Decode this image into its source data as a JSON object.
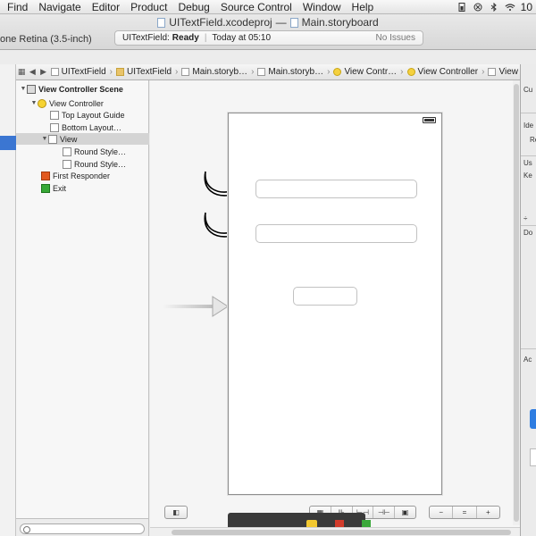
{
  "menu": [
    "Find",
    "Navigate",
    "Editor",
    "Product",
    "Debug",
    "Source Control",
    "Window",
    "Help"
  ],
  "status_bar": {
    "clock_fragment": "10",
    "icons": [
      "battery-status-icon",
      "sync-icon",
      "bluetooth-icon",
      "wifi-icon"
    ]
  },
  "window": {
    "project_file": "UITextField.xcodeproj",
    "separator": "—",
    "storyboard_file": "Main.storyboard"
  },
  "scheme": "one Retina (3.5-inch)",
  "activity": {
    "project": "UITextField:",
    "state": "Ready",
    "separator": "|",
    "time": "Today at 05:10",
    "issues": "No Issues"
  },
  "jumpbar": {
    "crumbs": [
      "UITextField",
      "UITextField",
      "Main.storyb…",
      "Main.storyb…",
      "View Contr…",
      "View Controller",
      "View"
    ],
    "back": "◀",
    "forward": "▶"
  },
  "outline": {
    "items": [
      {
        "label": "View Controller Scene",
        "icon": "scene-icon"
      },
      {
        "label": "View Controller",
        "icon": "view-controller-icon"
      },
      {
        "label": "Top Layout Guide",
        "icon": "layout-guide-icon"
      },
      {
        "label": "Bottom Layout…",
        "icon": "layout-guide-icon"
      },
      {
        "label": "View",
        "icon": "view-icon"
      },
      {
        "label": "Round Style…",
        "icon": "text-field-icon"
      },
      {
        "label": "Round Style…",
        "icon": "text-field-icon"
      },
      {
        "label": "First Responder",
        "icon": "first-responder-icon"
      },
      {
        "label": "Exit",
        "icon": "exit-icon"
      }
    ]
  },
  "canvas_controls": {
    "left_button": "◧",
    "layout_group": [
      "▦",
      "⊪",
      "⊢⊣",
      "⊣⊢",
      "▣"
    ],
    "zoom_group": [
      "−",
      "=",
      "+"
    ]
  },
  "inspector": {
    "labels": [
      "Cu",
      "Ide",
      "Re",
      "Us",
      "Ke",
      "÷",
      "Do",
      "Ac"
    ]
  },
  "colors": {
    "selection": "#3b76d2",
    "accent_blue": "#2f7de1"
  }
}
